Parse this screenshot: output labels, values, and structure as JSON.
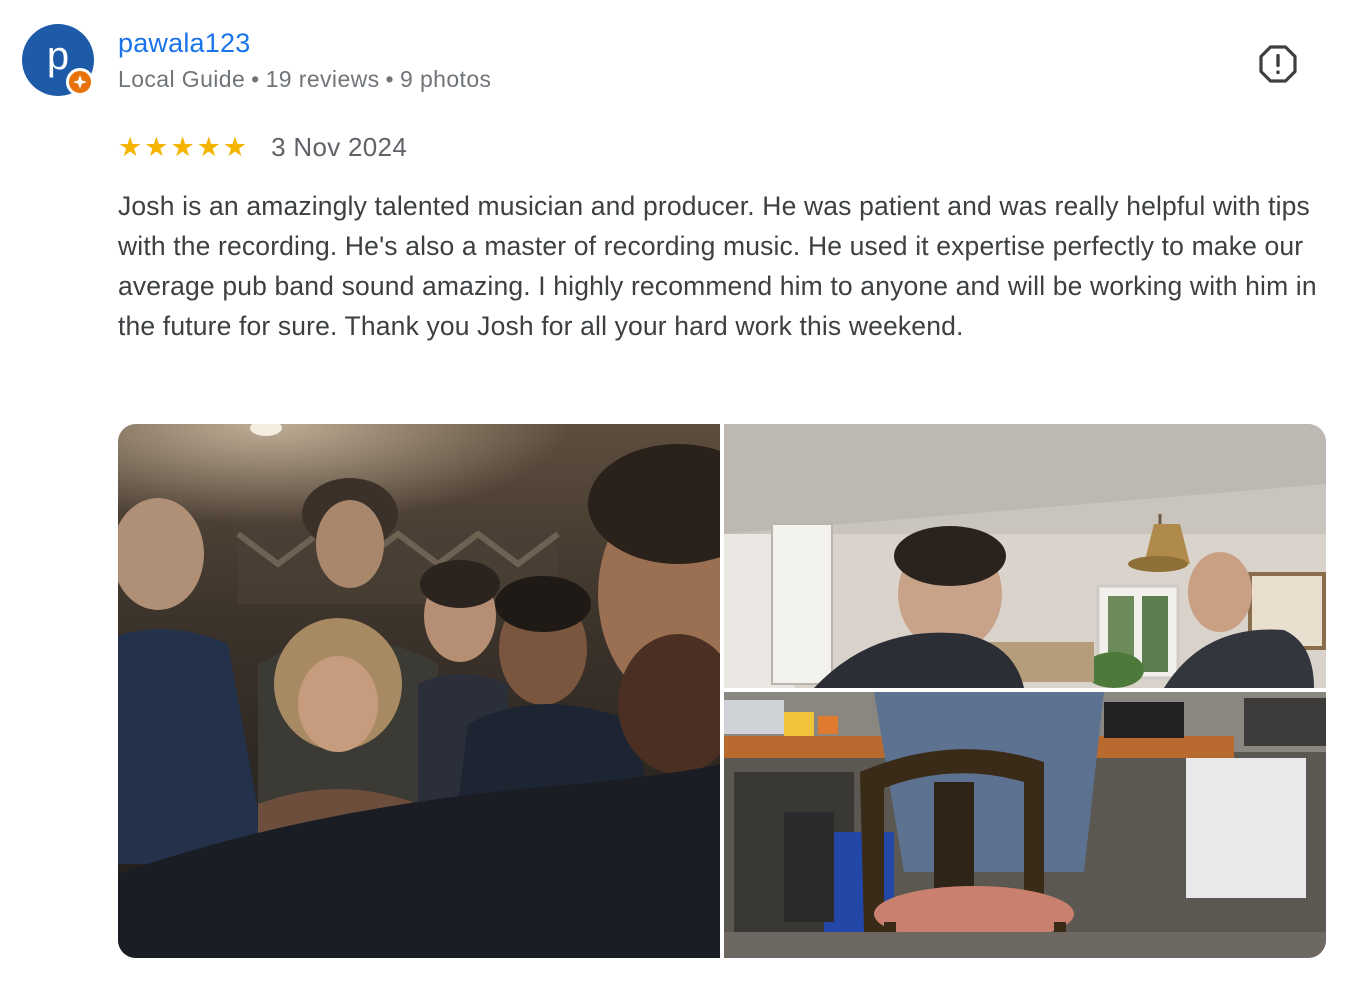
{
  "reviewer": {
    "avatar_letter": "p",
    "name": "pawala123",
    "badge": "Local Guide",
    "reviews": "19 reviews",
    "photos": "9 photos",
    "separator": "•"
  },
  "review": {
    "stars": [
      "★",
      "★",
      "★",
      "★",
      "★"
    ],
    "rating": 5,
    "date": "3 Nov 2024",
    "text": "Josh is an amazingly talented musician and producer. He was patient and was really helpful with tips with the recording. He's also a master of recording music. He used it expertise perfectly to make our average pub band sound amazing. I highly recommend him to anyone and will be working with him in the future for sure. Thank you Josh for all your hard work this weekend."
  },
  "icons": {
    "report": "report-flag-icon",
    "guide_badge": "local-guide-star-icon"
  },
  "colors": {
    "name_link": "#1a73e8",
    "star": "#f4b400",
    "avatar": "#1d5aa8",
    "badge": "#e8710a"
  }
}
